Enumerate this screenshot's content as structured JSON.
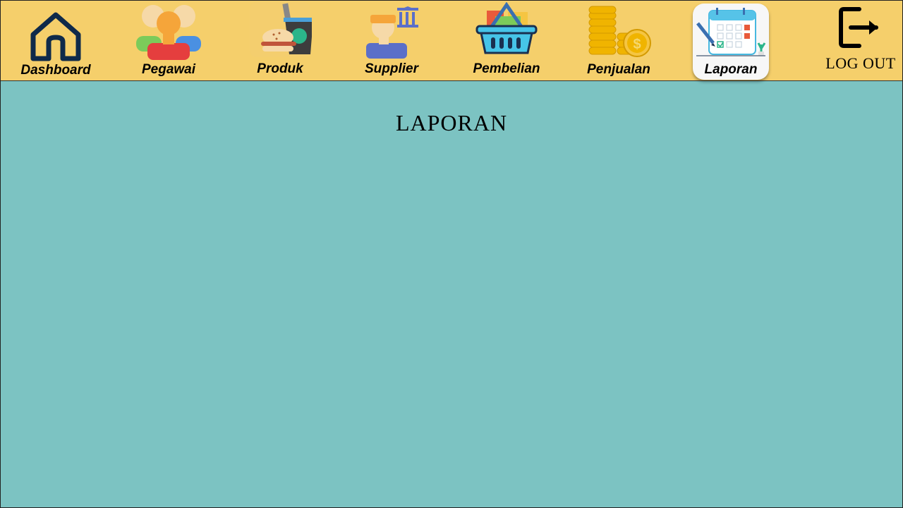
{
  "nav": {
    "items": [
      {
        "label": "Dashboard",
        "icon": "home-icon"
      },
      {
        "label": "Pegawai",
        "icon": "employees-icon"
      },
      {
        "label": "Produk",
        "icon": "food-drink-icon"
      },
      {
        "label": "Supplier",
        "icon": "supplier-icon"
      },
      {
        "label": "Pembelian",
        "icon": "shopping-basket-icon"
      },
      {
        "label": "Penjualan",
        "icon": "coins-icon"
      },
      {
        "label": "Laporan",
        "icon": "calendar-report-icon"
      }
    ],
    "active": "Laporan",
    "logout_label": "LOG OUT",
    "logout_icon": "logout-icon"
  },
  "main": {
    "title": "LAPORAN"
  },
  "colors": {
    "topbar": "#f5cf6b",
    "content_bg": "#7cc3c2",
    "active_card": "#f7f7f7"
  }
}
